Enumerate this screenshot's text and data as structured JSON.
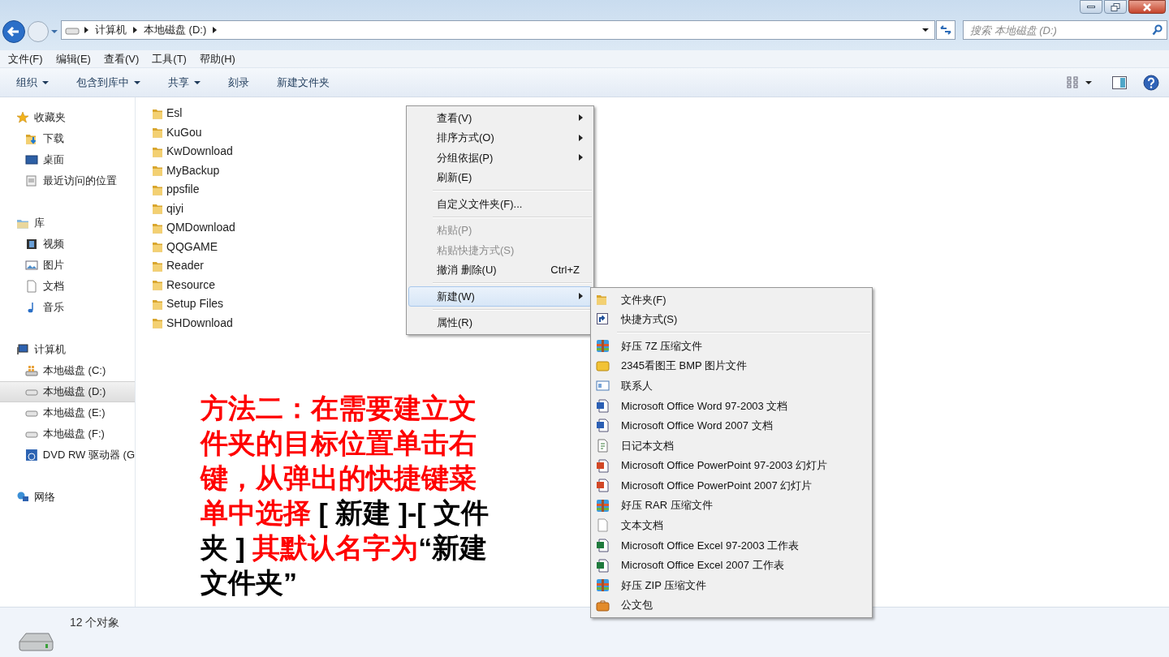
{
  "address_bar": {
    "crumbs": [
      "计算机",
      "本地磁盘 (D:)"
    ]
  },
  "search": {
    "placeholder": "搜索 本地磁盘 (D:)"
  },
  "menu_bar": [
    "文件(F)",
    "编辑(E)",
    "查看(V)",
    "工具(T)",
    "帮助(H)"
  ],
  "toolbar": [
    {
      "label": "组织",
      "dropdown": true
    },
    {
      "label": "包含到库中",
      "dropdown": true
    },
    {
      "label": "共享",
      "dropdown": true
    },
    {
      "label": "刻录",
      "dropdown": false
    },
    {
      "label": "新建文件夹",
      "dropdown": false
    }
  ],
  "nav_pane": [
    {
      "label": "收藏夹",
      "kind": "star",
      "children": [
        {
          "label": "下载",
          "kind": "download",
          "selected": false
        },
        {
          "label": "桌面",
          "kind": "desktop",
          "selected": false
        },
        {
          "label": "最近访问的位置",
          "kind": "recent",
          "selected": false
        }
      ]
    },
    {
      "label": "库",
      "kind": "library",
      "children": [
        {
          "label": "视频",
          "kind": "video",
          "selected": false
        },
        {
          "label": "图片",
          "kind": "picture",
          "selected": false
        },
        {
          "label": "文档",
          "kind": "document",
          "selected": false
        },
        {
          "label": "音乐",
          "kind": "music",
          "selected": false
        }
      ]
    },
    {
      "label": "计算机",
      "kind": "computer",
      "children": [
        {
          "label": "本地磁盘 (C:)",
          "kind": "system-drive",
          "selected": false
        },
        {
          "label": "本地磁盘 (D:)",
          "kind": "drive",
          "selected": true
        },
        {
          "label": "本地磁盘 (E:)",
          "kind": "drive",
          "selected": false
        },
        {
          "label": "本地磁盘 (F:)",
          "kind": "drive",
          "selected": false
        },
        {
          "label": "DVD RW 驱动器 (G",
          "kind": "dvd",
          "selected": false
        }
      ]
    },
    {
      "label": "网络",
      "kind": "network"
    }
  ],
  "files": [
    "Esl",
    "KuGou",
    "KwDownload",
    "MyBackup",
    "ppsfile",
    "qiyi",
    "QMDownload",
    "QQGAME",
    "Reader",
    "Resource",
    "Setup Files",
    "SHDownload"
  ],
  "context_menu": [
    {
      "kind": "item",
      "label": "查看(V)",
      "submenu": true,
      "disabled": false,
      "selected": false
    },
    {
      "kind": "item",
      "label": "排序方式(O)",
      "submenu": true,
      "disabled": false,
      "selected": false
    },
    {
      "kind": "item",
      "label": "分组依据(P)",
      "submenu": true,
      "disabled": false,
      "selected": false
    },
    {
      "kind": "item",
      "label": "刷新(E)",
      "submenu": false,
      "disabled": false,
      "selected": false
    },
    {
      "kind": "separator"
    },
    {
      "kind": "item",
      "label": "自定义文件夹(F)...",
      "submenu": false,
      "disabled": false,
      "selected": false
    },
    {
      "kind": "separator"
    },
    {
      "kind": "item",
      "label": "粘贴(P)",
      "submenu": false,
      "disabled": true,
      "selected": false
    },
    {
      "kind": "item",
      "label": "粘贴快捷方式(S)",
      "submenu": false,
      "disabled": true,
      "selected": false
    },
    {
      "kind": "item",
      "label": "撤消 删除(U)",
      "shortcut": "Ctrl+Z",
      "submenu": false,
      "disabled": false,
      "selected": false
    },
    {
      "kind": "separator"
    },
    {
      "kind": "item",
      "label": "新建(W)",
      "submenu": true,
      "disabled": false,
      "selected": true
    },
    {
      "kind": "separator"
    },
    {
      "kind": "item",
      "label": "属性(R)",
      "submenu": false,
      "disabled": false,
      "selected": false
    }
  ],
  "new_submenu": [
    {
      "kind": "folder",
      "label": "文件夹(F)"
    },
    {
      "kind": "shortcut",
      "label": "快捷方式(S)"
    },
    {
      "kind": "separator"
    },
    {
      "kind": "archive",
      "label": "好压 7Z 压缩文件"
    },
    {
      "kind": "bmp",
      "label": "2345看图王 BMP 图片文件"
    },
    {
      "kind": "contact",
      "label": "联系人"
    },
    {
      "kind": "word",
      "label": "Microsoft Office Word 97-2003 文档"
    },
    {
      "kind": "word",
      "label": "Microsoft Office Word 2007 文档"
    },
    {
      "kind": "journal",
      "label": "日记本文档"
    },
    {
      "kind": "powerpoint",
      "label": "Microsoft Office PowerPoint 97-2003 幻灯片"
    },
    {
      "kind": "powerpoint",
      "label": "Microsoft Office PowerPoint 2007 幻灯片"
    },
    {
      "kind": "archive",
      "label": "好压 RAR 压缩文件"
    },
    {
      "kind": "text",
      "label": "文本文档"
    },
    {
      "kind": "excel",
      "label": "Microsoft Office Excel 97-2003 工作表"
    },
    {
      "kind": "excel",
      "label": "Microsoft Office Excel 2007 工作表"
    },
    {
      "kind": "archive",
      "label": "好压 ZIP 压缩文件"
    },
    {
      "kind": "briefcase",
      "label": "公文包"
    }
  ],
  "annotation": [
    {
      "text": "方法二：在需要建立文件夹的目标位置单击右键，从弹出的快捷键菜单中选择",
      "color": "#ff0000"
    },
    {
      "text": " [ 新建 ]-[ 文件夹 ] ",
      "color": "#000000"
    },
    {
      "text": "其默认名字为",
      "color": "#ff0000"
    },
    {
      "text": "“新建文件夹”",
      "color": "#000000"
    }
  ],
  "status_bar": {
    "count": "12 个对象"
  }
}
